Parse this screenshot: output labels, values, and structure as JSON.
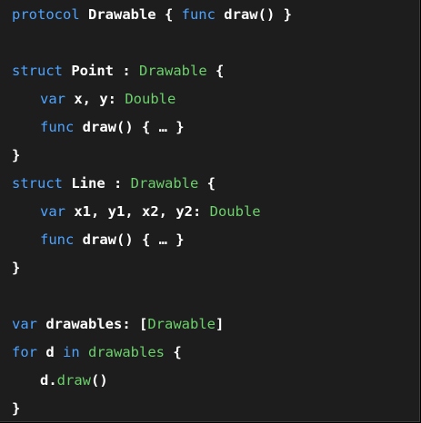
{
  "code": {
    "line1": {
      "kw1": "protocol",
      "t1": " Drawable { ",
      "kw2": "func",
      "t2": " draw() }"
    },
    "line2": {
      "kw1": "struct",
      "t1": " Point : ",
      "ty1": "Drawable",
      "t2": " {"
    },
    "line3": {
      "kw1": "var",
      "t1": " x, y: ",
      "ty1": "Double"
    },
    "line4": {
      "kw1": "func",
      "t1": " draw() { … }"
    },
    "line5": {
      "t1": "}"
    },
    "line6": {
      "kw1": "struct",
      "t1": " Line : ",
      "ty1": "Drawable",
      "t2": " {"
    },
    "line7": {
      "kw1": "var",
      "t1": " x1, y1, x2, y2: ",
      "ty1": "Double"
    },
    "line8": {
      "kw1": "func",
      "t1": " draw() { … }"
    },
    "line9": {
      "t1": "}"
    },
    "line10": {
      "kw1": "var",
      "t1": " drawables: [",
      "ty1": "Drawable",
      "t2": "]"
    },
    "line11": {
      "kw1": "for",
      "t1": " d ",
      "kw2": "in",
      "t2": " ",
      "ty1": "drawables",
      "t3": " {"
    },
    "line12": {
      "t1": "d.",
      "fn1": "draw",
      "t2": "()"
    },
    "line13": {
      "t1": "}"
    }
  },
  "colors": {
    "background": "#1d1d1d",
    "keyword": "#4da3ff",
    "type": "#6bd16b",
    "plain": "#ffffff"
  }
}
